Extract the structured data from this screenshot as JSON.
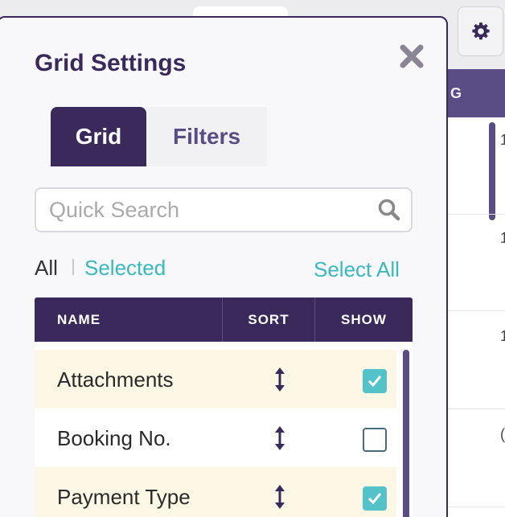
{
  "background": {
    "header_text": "G",
    "row_chars": [
      "1",
      "1",
      "1",
      "("
    ]
  },
  "panel": {
    "title": "Grid Settings",
    "close_icon": "close-x-icon"
  },
  "tabs": [
    {
      "label": "Grid",
      "active": true
    },
    {
      "label": "Filters",
      "active": false
    }
  ],
  "search": {
    "placeholder": "Quick Search",
    "value": ""
  },
  "filters": {
    "all_label": "All",
    "selected_label": "Selected",
    "select_all_label": "Select All"
  },
  "table": {
    "columns": [
      "NAME",
      "SORT",
      "SHOW"
    ],
    "rows": [
      {
        "name": "Attachments",
        "show": true
      },
      {
        "name": "Booking No.",
        "show": false
      },
      {
        "name": "Payment Type",
        "show": true
      }
    ]
  },
  "colors": {
    "primary": "#3a2a5c",
    "accent": "#3ab8c0",
    "highlight_row": "#fdf8e6"
  }
}
